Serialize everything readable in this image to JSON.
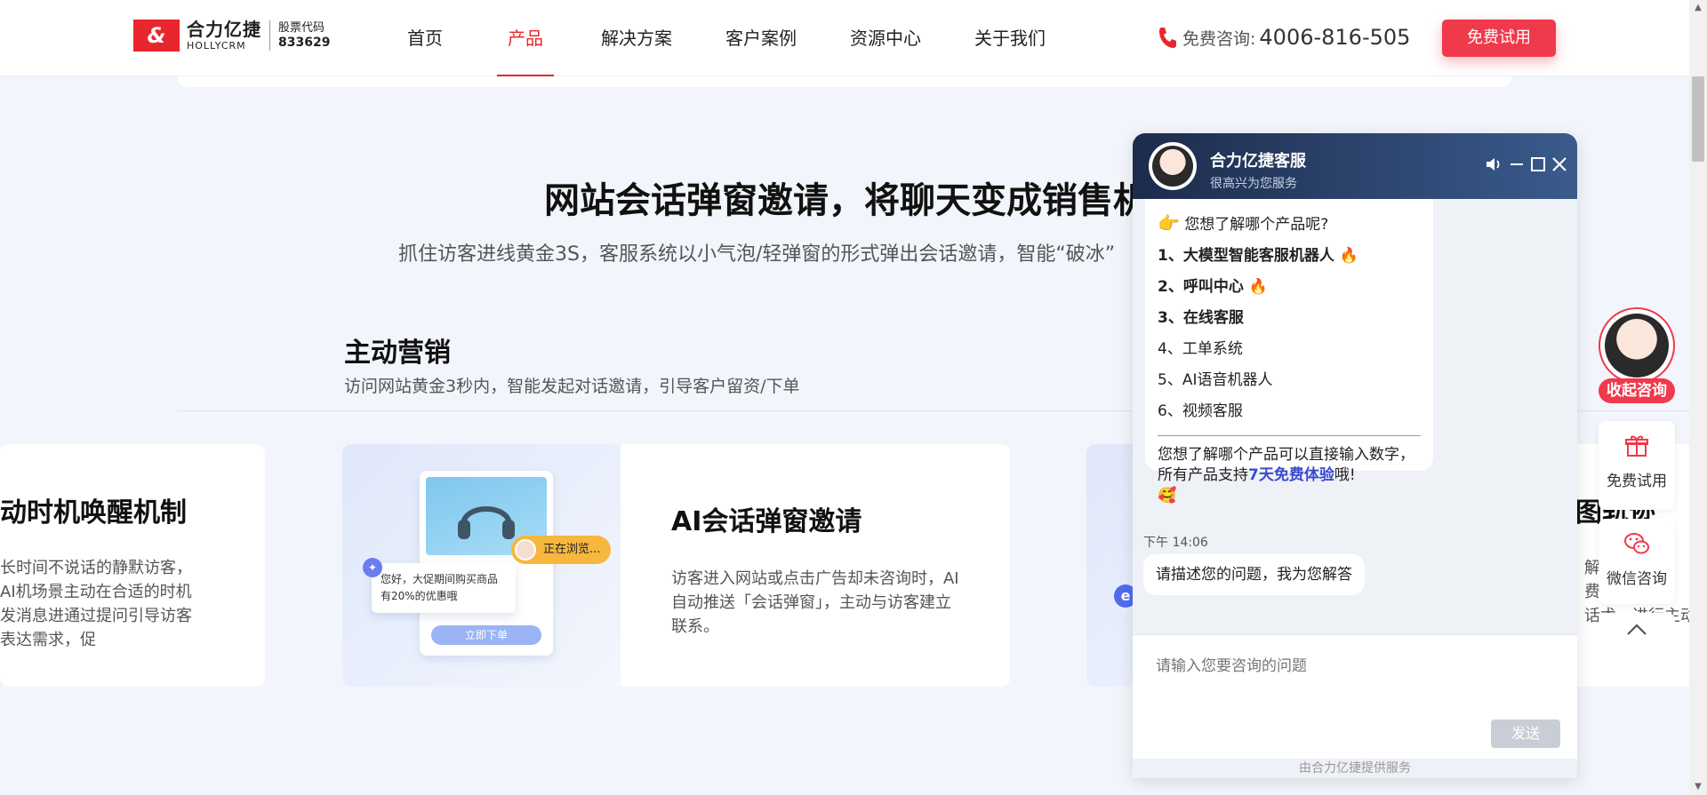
{
  "header": {
    "logo_mark": "&",
    "logo_cn": "合力亿捷",
    "logo_en": "HOLLYCRM",
    "stock_label": "股票代码",
    "stock_code": "833629",
    "nav": [
      "首页",
      "产品",
      "解决方案",
      "客户案例",
      "资源中心",
      "关于我们"
    ],
    "active_nav": "产品",
    "hotline_label": "免费咨询:",
    "hotline_number": "4006-816-505",
    "trial_button": "免费试用",
    "accent_color": "#e8262d"
  },
  "section": {
    "title": "网站会话弹窗邀请，将聊天变成销售机会",
    "subtitle": "抓住访客进线黄金3S，客服系统以小气泡/轻弹窗的形式弹出会话邀请，智能“破冰”",
    "marketing_title": "主动营销",
    "marketing_subtitle": "访问网站黄金3秒内，智能发起对话邀请，引导客户留资/下单"
  },
  "cards": {
    "left": {
      "title": "动时机唤醒机制",
      "desc": "长时间不说话的静默访客，AI机场景主动在合适的时机发消息进通过提问引导访客表达需求，促"
    },
    "middle": {
      "title": "AI会话弹窗邀请",
      "desc": "访客进入网站或点击广告却未咨询时，AI自动推送「会话弹窗」，主动与访客建立联系。",
      "browse_tag": "正在浏览...",
      "promo_text": "您好，大促期间购买商品有20%的优惠哦",
      "order_button": "立即下单"
    },
    "right": {
      "title": "图轨迹",
      "desc_lines": [
        "解",
        "费调",
        "话术，进行主动营"
      ]
    }
  },
  "chat": {
    "agent_name": "合力亿捷客服",
    "agent_status": "很高兴为您服务",
    "menu_intro": "您想了解哪个产品呢?",
    "menu_items": [
      {
        "text": "1、大模型智能客服机器人",
        "bold": true,
        "hot": true
      },
      {
        "text": "2、呼叫中心",
        "bold": true,
        "hot": true
      },
      {
        "text": "3、在线客服",
        "bold": true,
        "hot": false
      },
      {
        "text": "4、工单系统",
        "bold": false,
        "hot": false
      },
      {
        "text": "5、AI语音机器人",
        "bold": false,
        "hot": false
      },
      {
        "text": "6、视频客服",
        "bold": false,
        "hot": false
      }
    ],
    "foot_text_1": "您想了解哪个产品可以直接输入数字，所有产品支持",
    "foot_highlight": "7天免费体验",
    "foot_text_2": "哦!",
    "time": "下午 14:06",
    "reply": "请描述您的问题，我为您解答",
    "input_placeholder": "请输入您要咨询的问题",
    "send_button": "发送",
    "footer": "由合力亿捷提供服务",
    "header_gradient": [
      "#1d2b4c",
      "#3a5b8c"
    ]
  },
  "float_bar": {
    "collapse_label": "收起咨询",
    "trial_label": "免费试用",
    "wechat_label": "微信咨询"
  }
}
